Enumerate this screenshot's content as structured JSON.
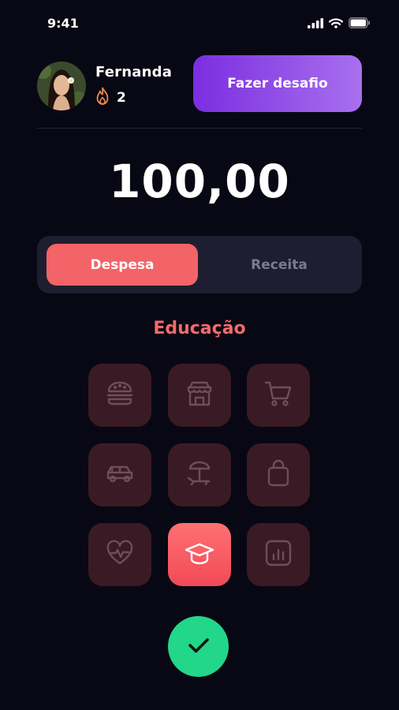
{
  "status_bar": {
    "time": "9:41"
  },
  "user": {
    "name": "Fernanda",
    "streak": "2"
  },
  "header": {
    "challenge_label": "Fazer desafio"
  },
  "amount": "100,00",
  "toggle": {
    "expense_label": "Despesa",
    "income_label": "Receita",
    "selected": "Despesa"
  },
  "category": {
    "selected_label": "Educação",
    "icons": [
      "burger-icon",
      "store-icon",
      "cart-icon",
      "car-icon",
      "beach-icon",
      "shopping-bag-icon",
      "health-icon",
      "graduation-cap-icon",
      "chart-icon"
    ]
  },
  "colors": {
    "background": "#080814",
    "accent_red": "#f26467",
    "accent_purple": "#8a3fe6",
    "confirm_green": "#22d68a",
    "tile": "#3a1a25"
  }
}
